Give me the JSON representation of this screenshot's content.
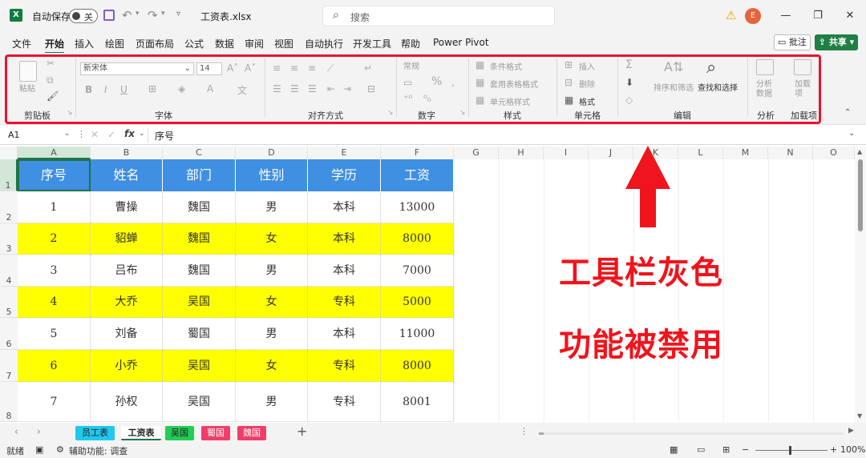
{
  "titlebar": {
    "autosave_label": "自动保存",
    "autosave_state": "关",
    "filename": "工资表.xlsx",
    "search_placeholder": "搜索",
    "avatar_letter": "E"
  },
  "menu": {
    "tabs": [
      "文件",
      "开始",
      "插入",
      "绘图",
      "页面布局",
      "公式",
      "数据",
      "审阅",
      "视图",
      "自动执行",
      "开发工具",
      "帮助",
      "Power Pivot"
    ],
    "active": "开始",
    "comment_label": "批注",
    "share_label": "共享"
  },
  "ribbon": {
    "font_name": "新宋体",
    "font_size": "14",
    "paste_label": "粘贴",
    "number_format": "常规",
    "cond_format": "条件格式",
    "table_format": "套用表格格式",
    "cell_style": "单元格样式",
    "insert_label": "插入",
    "delete_label": "删除",
    "format_label": "格式",
    "sort_filter": "排序和筛选",
    "find_select": "查找和选择",
    "analyze_data": "分析数据",
    "addins": "加载项",
    "groups": {
      "clipboard": "剪贴板",
      "font": "字体",
      "align": "对齐方式",
      "number": "数字",
      "style": "样式",
      "cells": "单元格",
      "edit": "编辑",
      "analyze": "分析",
      "addins": "加载项"
    }
  },
  "formula_bar": {
    "cell_ref": "A1",
    "fx": "fx",
    "content": "序号"
  },
  "sheet": {
    "columns": [
      "A",
      "B",
      "C",
      "D",
      "E",
      "F",
      "G",
      "H",
      "I",
      "J",
      "K",
      "L",
      "M",
      "N",
      "O"
    ],
    "rows": [
      "1",
      "2",
      "3",
      "4",
      "5",
      "6",
      "7",
      "8"
    ],
    "header": [
      "序号",
      "姓名",
      "部门",
      "性别",
      "学历",
      "工资"
    ],
    "data": [
      [
        "1",
        "曹操",
        "魏国",
        "男",
        "本科",
        "13000"
      ],
      [
        "2",
        "貂蝉",
        "魏国",
        "女",
        "本科",
        "8000"
      ],
      [
        "3",
        "吕布",
        "魏国",
        "男",
        "本科",
        "7000"
      ],
      [
        "4",
        "大乔",
        "吴国",
        "女",
        "专科",
        "5000"
      ],
      [
        "5",
        "刘备",
        "蜀国",
        "男",
        "本科",
        "11000"
      ],
      [
        "6",
        "小乔",
        "吴国",
        "女",
        "专科",
        "8000"
      ],
      [
        "7",
        "孙权",
        "吴国",
        "男",
        "专科",
        "8001"
      ]
    ],
    "highlight_color": "#ffff00",
    "header_color": "#3f8fe2"
  },
  "annotation": {
    "line1": "工具栏灰色",
    "line2": "功能被禁用"
  },
  "tabs": [
    {
      "label": "员工表",
      "color": "#1fc8ee"
    },
    {
      "label": "工资表",
      "color": "#ffffff"
    },
    {
      "label": "吴国",
      "color": "#22cc55"
    },
    {
      "label": "蜀国",
      "color": "#ef3e6a"
    },
    {
      "label": "魏国",
      "color": "#ef3e6a"
    }
  ],
  "status": {
    "ready": "就绪",
    "accessibility": "辅助功能: 调查",
    "zoom": "100%"
  }
}
